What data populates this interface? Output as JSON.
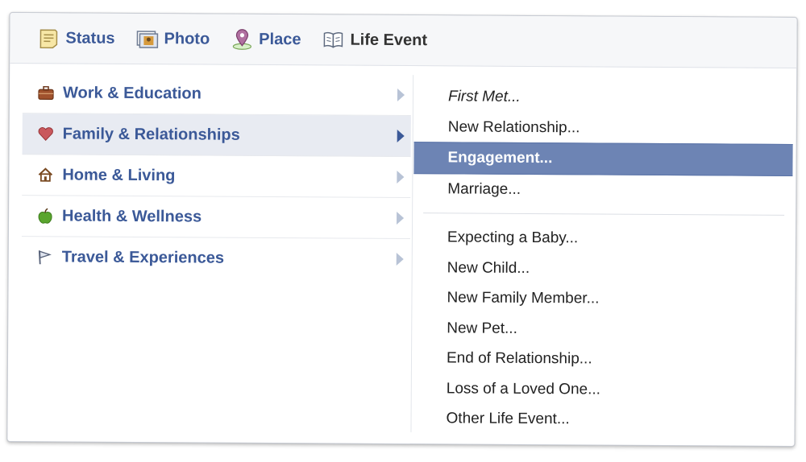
{
  "composer": {
    "tabs": [
      {
        "label": "Status",
        "icon": "status-note-icon"
      },
      {
        "label": "Photo",
        "icon": "photo-icon"
      },
      {
        "label": "Place",
        "icon": "place-pin-icon"
      },
      {
        "label": "Life Event",
        "icon": "book-icon",
        "active": true
      }
    ]
  },
  "categories": [
    {
      "label": "Work & Education",
      "icon": "briefcase-icon"
    },
    {
      "label": "Family & Relationships",
      "icon": "heart-icon",
      "selected": true
    },
    {
      "label": "Home & Living",
      "icon": "house-icon"
    },
    {
      "label": "Health & Wellness",
      "icon": "apple-icon"
    },
    {
      "label": "Travel & Experiences",
      "icon": "flag-icon"
    }
  ],
  "submenu": {
    "group1": [
      "First Met...",
      "New Relationship...",
      "Engagement...",
      "Marriage..."
    ],
    "group2": [
      "Expecting a Baby...",
      "New Child...",
      "New Family Member...",
      "New Pet...",
      "End of Relationship...",
      "Loss of a Loved One...",
      "Other Life Event..."
    ],
    "highlighted": "Engagement..."
  },
  "colors": {
    "link": "#3b5998",
    "highlight": "#6d84b4",
    "selected_bg": "#e8ebf2"
  }
}
